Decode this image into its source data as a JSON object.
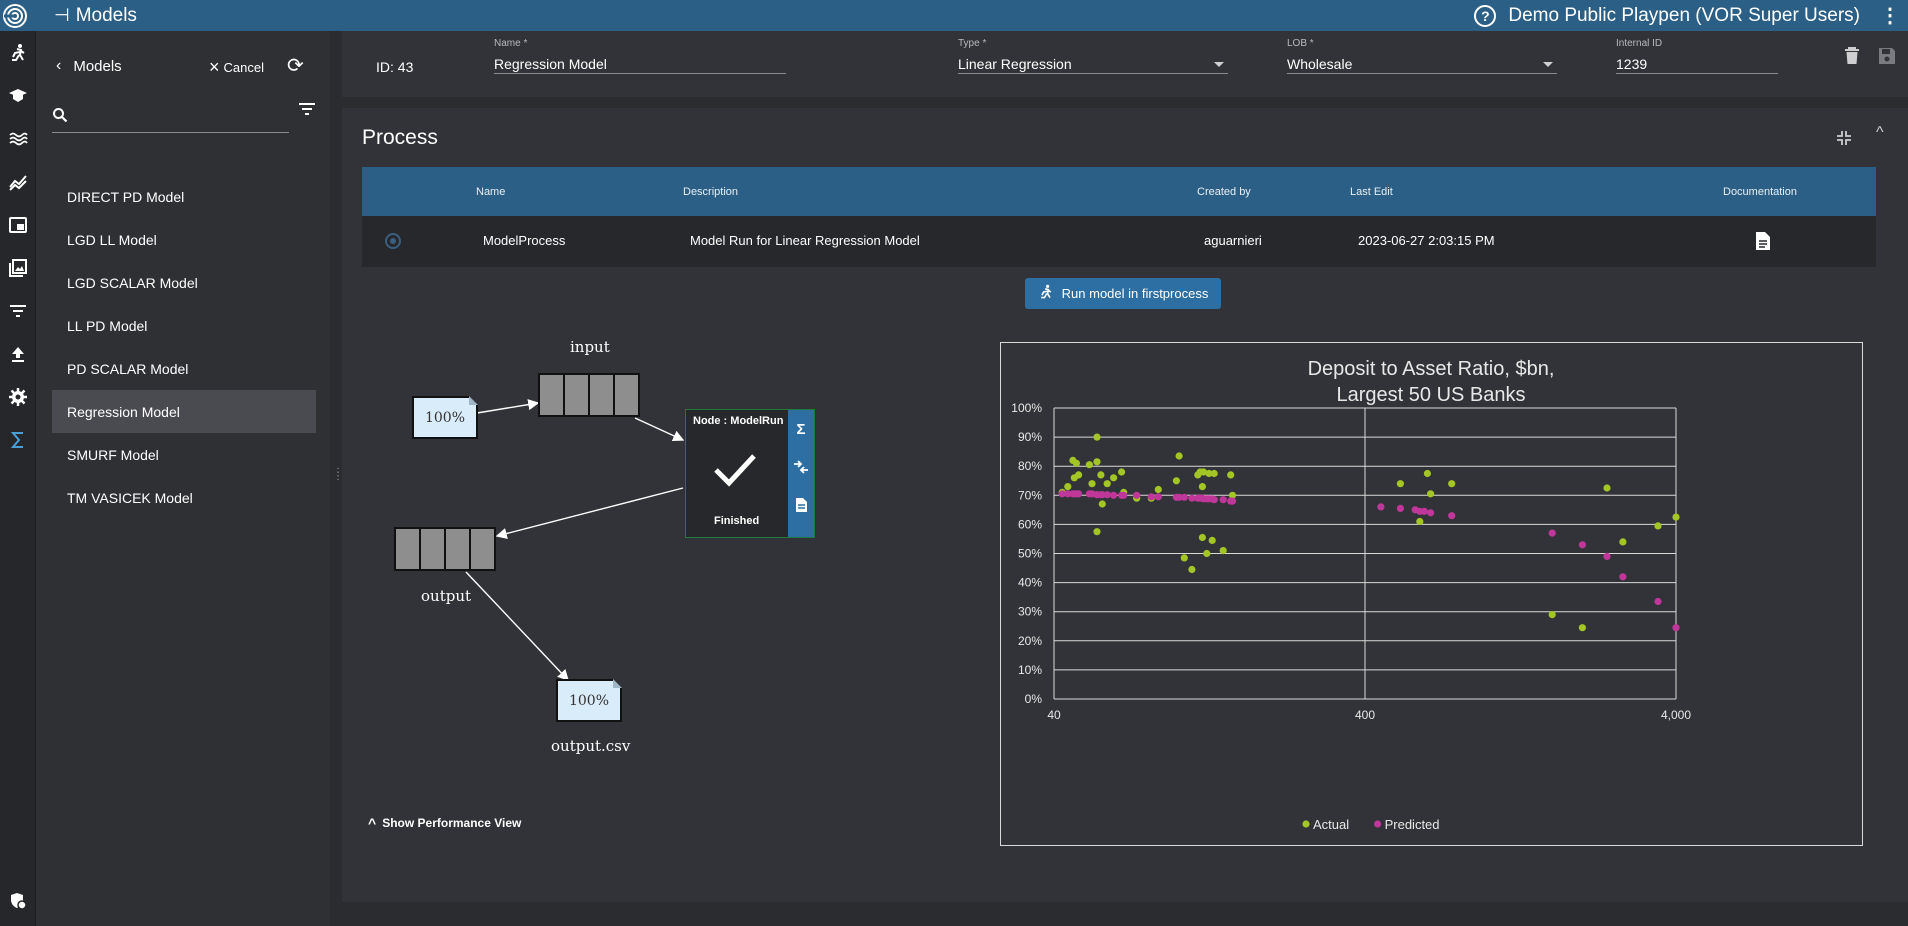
{
  "topbar": {
    "title": "Models",
    "org": "Demo Public Playpen (VOR Super Users)"
  },
  "rail": {
    "icons": [
      "logo-icon",
      "run-icon",
      "school-icon",
      "waves-icon",
      "trend-icon",
      "picture-in-picture-icon",
      "gallery-icon",
      "filter-icon",
      "upload-icon",
      "settings-icon",
      "sigma-icon",
      "security-icon"
    ]
  },
  "sidebar": {
    "back_label": "Models",
    "cancel_label": "Cancel",
    "search_placeholder": "",
    "items": [
      {
        "label": "DIRECT PD Model"
      },
      {
        "label": "LGD LL Model"
      },
      {
        "label": "LGD SCALAR Model"
      },
      {
        "label": "LL PD Model"
      },
      {
        "label": "PD SCALAR Model"
      },
      {
        "label": "Regression Model"
      },
      {
        "label": "SMURF Model"
      },
      {
        "label": "TM VASICEK Model"
      }
    ],
    "selected": "Regression Model"
  },
  "header": {
    "id_text": "ID: 43",
    "name_label": "Name *",
    "name_value": "Regression Model",
    "type_label": "Type *",
    "type_value": "Linear Regression",
    "lob_label": "LOB *",
    "lob_value": "Wholesale",
    "internal_id_label": "Internal ID",
    "internal_id_value": "1239"
  },
  "process": {
    "title": "Process",
    "columns": [
      "Name",
      "Description",
      "Created by",
      "Last Edit",
      "Documentation"
    ],
    "row": {
      "name": "ModelProcess",
      "description": "Model Run for Linear Regression Model",
      "created_by": "aguarnieri",
      "last_edit": "2023-06-27 2:03:15 PM"
    },
    "run_button": "Run model in firstprocess",
    "perf_toggle": "Show Performance View"
  },
  "flow": {
    "input_label": "input",
    "output_label": "output",
    "output_file_label": "output.csv",
    "input_file_pct": "100%",
    "output_file_pct": "100%",
    "node_title": "Node : ModelRun",
    "node_status": "Finished"
  },
  "chart_data": {
    "type": "scatter",
    "title_line1": "Deposit to Asset Ratio, $bn,",
    "title_line2": "Largest 50 US Banks",
    "xscale": "log",
    "xlim": [
      40,
      4000
    ],
    "xticks": [
      "40",
      "400",
      "4,000"
    ],
    "ylim": [
      0,
      100
    ],
    "yticks": [
      "0%",
      "10%",
      "20%",
      "30%",
      "40%",
      "50%",
      "60%",
      "70%",
      "80%",
      "90%",
      "100%"
    ],
    "grid": true,
    "legend_position": "bottom",
    "colors": {
      "Actual": "#a3c526",
      "Predicted": "#c0379a"
    },
    "series": [
      {
        "name": "Actual",
        "points": [
          [
            42.5,
            71
          ],
          [
            44.3,
            73
          ],
          [
            46,
            82
          ],
          [
            46.5,
            76
          ],
          [
            47.2,
            81
          ],
          [
            48,
            77
          ],
          [
            52,
            80.5
          ],
          [
            53,
            74
          ],
          [
            55,
            90
          ],
          [
            55,
            81.5
          ],
          [
            55,
            57.5
          ],
          [
            56.6,
            77
          ],
          [
            57.2,
            67
          ],
          [
            59.3,
            74
          ],
          [
            62.2,
            76
          ],
          [
            66,
            78
          ],
          [
            67,
            71
          ],
          [
            73.8,
            69
          ],
          [
            82.2,
            69
          ],
          [
            86.6,
            72
          ],
          [
            99,
            75
          ],
          [
            101,
            83.5
          ],
          [
            105,
            48.5
          ],
          [
            111,
            44.5
          ],
          [
            116,
            77
          ],
          [
            118,
            78
          ],
          [
            120,
            73
          ],
          [
            120,
            55.5
          ],
          [
            121,
            78
          ],
          [
            124,
            50
          ],
          [
            126,
            77.5
          ],
          [
            129,
            54.5
          ],
          [
            131,
            77.5
          ],
          [
            140,
            51
          ],
          [
            148,
            77
          ],
          [
            150,
            70
          ],
          [
            520,
            74
          ],
          [
            600,
            61
          ],
          [
            635,
            77.5
          ],
          [
            650,
            70.5
          ],
          [
            760,
            74
          ],
          [
            1600,
            29
          ],
          [
            2000,
            24.5
          ],
          [
            2400,
            72.5
          ],
          [
            2700,
            54
          ],
          [
            3500,
            59.5
          ],
          [
            4000,
            62.5
          ]
        ]
      },
      {
        "name": "Predicted",
        "points": [
          [
            42.5,
            70.5
          ],
          [
            44.3,
            70.5
          ],
          [
            46,
            70.5
          ],
          [
            46.5,
            70.5
          ],
          [
            47.2,
            70.5
          ],
          [
            48,
            70.5
          ],
          [
            52,
            70.5
          ],
          [
            53,
            70.5
          ],
          [
            55,
            70.2
          ],
          [
            55,
            70.2
          ],
          [
            56.6,
            70.2
          ],
          [
            57.2,
            70.2
          ],
          [
            59.3,
            70.2
          ],
          [
            62.2,
            70
          ],
          [
            66,
            70
          ],
          [
            67,
            70
          ],
          [
            73.8,
            70
          ],
          [
            82.2,
            69.5
          ],
          [
            86.6,
            69.5
          ],
          [
            99,
            69.3
          ],
          [
            101,
            69.3
          ],
          [
            105,
            69.3
          ],
          [
            111,
            69
          ],
          [
            116,
            69
          ],
          [
            118,
            69
          ],
          [
            120,
            69
          ],
          [
            121,
            68.8
          ],
          [
            124,
            68.8
          ],
          [
            126,
            68.8
          ],
          [
            129,
            68.8
          ],
          [
            131,
            68.5
          ],
          [
            140,
            68.5
          ],
          [
            148,
            68
          ],
          [
            150,
            68
          ],
          [
            450,
            66
          ],
          [
            520,
            65.5
          ],
          [
            580,
            65
          ],
          [
            600,
            64.5
          ],
          [
            620,
            64.5
          ],
          [
            650,
            64
          ],
          [
            760,
            63
          ],
          [
            1600,
            57
          ],
          [
            2000,
            53
          ],
          [
            2400,
            49
          ],
          [
            2700,
            42
          ],
          [
            3500,
            33.5
          ],
          [
            4000,
            24.5
          ]
        ]
      }
    ]
  }
}
